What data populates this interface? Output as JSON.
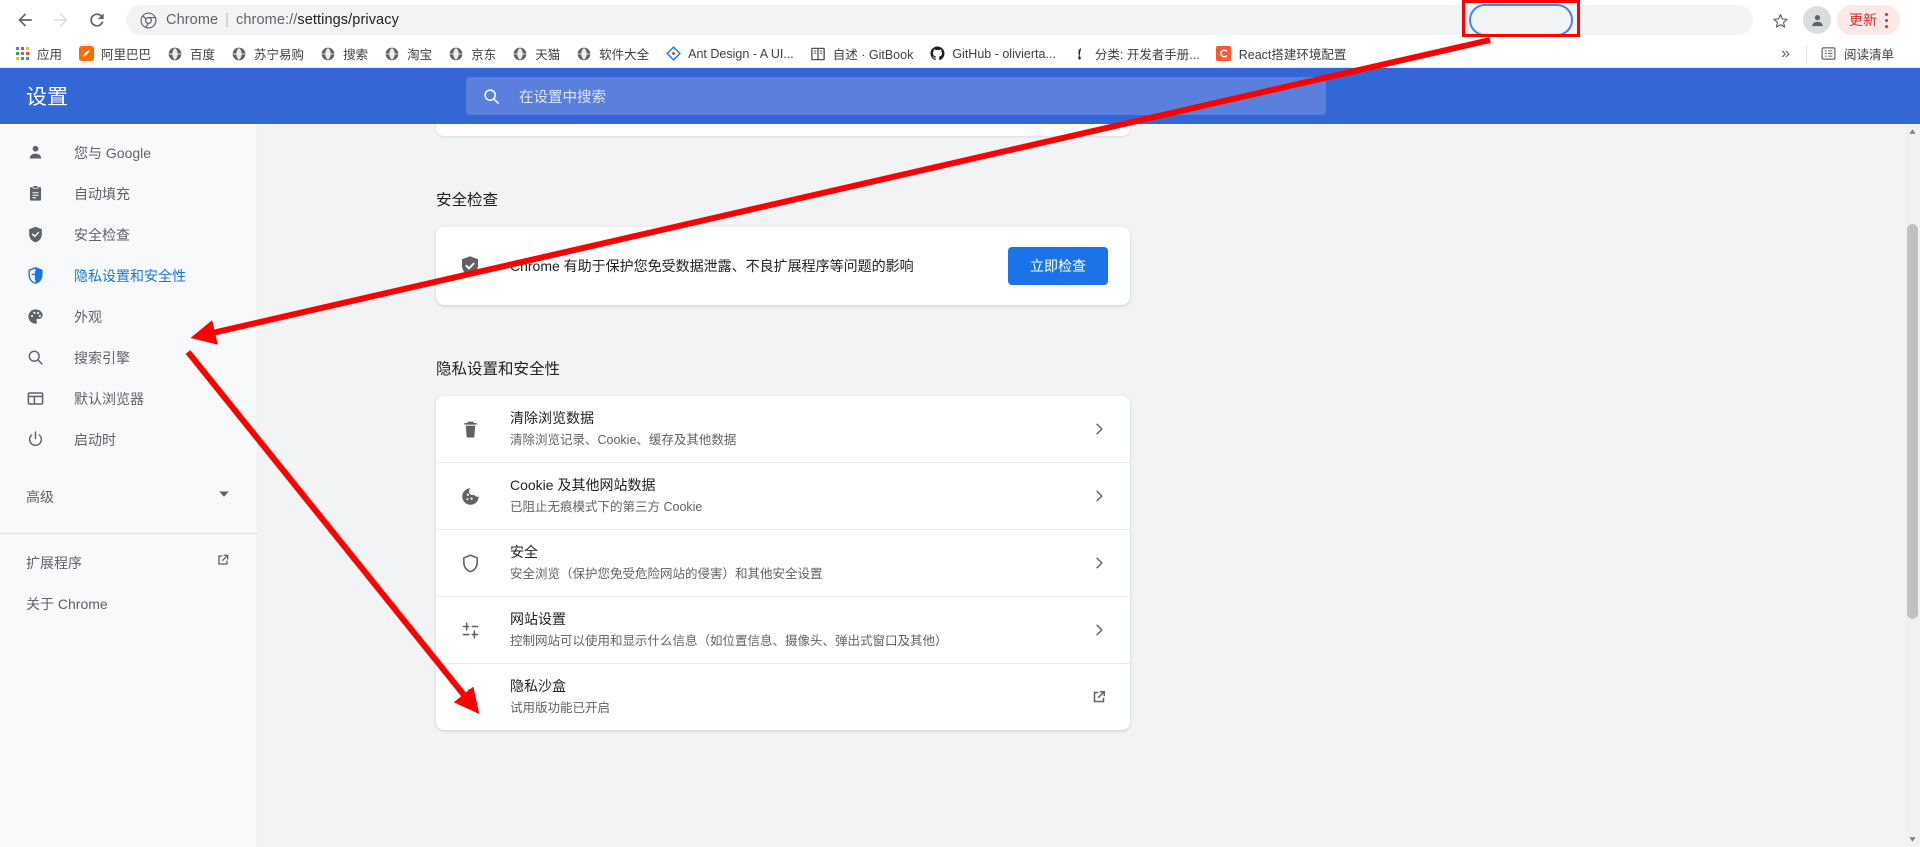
{
  "browser": {
    "nav": {
      "back_label": "后退",
      "forward_label": "前进",
      "reload_label": "重新加载"
    },
    "omnibox": {
      "site_label": "Chrome",
      "separator": "|",
      "url_scheme": "chrome://",
      "url_path": "settings/privacy",
      "full_url": "chrome://settings/privacy"
    },
    "actions": {
      "bookmark_label": "为此标签页添加书签",
      "profile_label": "个人资料",
      "update_label": "更新",
      "menu_label": "自定义及控制 Google Chrome"
    },
    "bookmarks": [
      {
        "label": "应用",
        "icon": "apps-grid-icon"
      },
      {
        "label": "阿里巴巴",
        "icon": "alibaba-icon"
      },
      {
        "label": "百度",
        "icon": "globe-icon"
      },
      {
        "label": "苏宁易购",
        "icon": "globe-icon"
      },
      {
        "label": "搜索",
        "icon": "globe-icon"
      },
      {
        "label": "淘宝",
        "icon": "globe-icon"
      },
      {
        "label": "京东",
        "icon": "globe-icon"
      },
      {
        "label": "天猫",
        "icon": "globe-icon"
      },
      {
        "label": "软件大全",
        "icon": "globe-icon"
      },
      {
        "label": "Ant Design - A UI...",
        "icon": "antdesign-icon"
      },
      {
        "label": "自述 · GitBook",
        "icon": "gitbook-icon"
      },
      {
        "label": "GitHub - olivierta...",
        "icon": "github-icon"
      },
      {
        "label": "分类: 开发者手册...",
        "icon": "brush-icon"
      },
      {
        "label": "React搭建环境配置",
        "icon": "csdn-icon"
      }
    ],
    "bookmarks_overflow": "»",
    "reading_list": {
      "label": "阅读清单",
      "icon": "reading-list-icon"
    }
  },
  "settings": {
    "title": "设置",
    "search": {
      "placeholder": "在设置中搜索",
      "icon": "search-icon"
    },
    "sidebar": {
      "items": [
        {
          "label": "您与 Google",
          "icon": "person-icon",
          "active": false
        },
        {
          "label": "自动填充",
          "icon": "clipboard-icon",
          "active": false
        },
        {
          "label": "安全检查",
          "icon": "shield-check-icon",
          "active": false
        },
        {
          "label": "隐私设置和安全性",
          "icon": "shield-blue-icon",
          "active": true
        },
        {
          "label": "外观",
          "icon": "palette-icon",
          "active": false
        },
        {
          "label": "搜索引擎",
          "icon": "search-icon",
          "active": false
        },
        {
          "label": "默认浏览器",
          "icon": "browser-window-icon",
          "active": false
        },
        {
          "label": "启动时",
          "icon": "power-icon",
          "active": false
        }
      ],
      "advanced": {
        "label": "高级",
        "icon": "chevron-down-icon"
      },
      "links": [
        {
          "label": "扩展程序",
          "icon": "open-in-new-icon"
        },
        {
          "label": "关于 Chrome",
          "icon": "none"
        }
      ]
    },
    "main": {
      "safety_check": {
        "heading": "安全检查",
        "icon": "shield-check-icon",
        "description": "Chrome 有助于保护您免受数据泄露、不良扩展程序等问题的影响",
        "button_label": "立即检查"
      },
      "privacy": {
        "heading": "隐私设置和安全性",
        "rows": [
          {
            "icon": "trash-icon",
            "title": "清除浏览数据",
            "subtitle": "清除浏览记录、Cookie、缓存及其他数据",
            "end_icon": "chevron-right-icon"
          },
          {
            "icon": "cookie-icon",
            "title": "Cookie 及其他网站数据",
            "subtitle": "已阻止无痕模式下的第三方 Cookie",
            "end_icon": "chevron-right-icon"
          },
          {
            "icon": "shield-outline-icon",
            "title": "安全",
            "subtitle": "安全浏览（保护您免受危险网站的侵害）和其他安全设置",
            "end_icon": "chevron-right-icon"
          },
          {
            "icon": "sliders-icon",
            "title": "网站设置",
            "subtitle": "控制网站可以使用和显示什么信息（如位置信息、摄像头、弹出式窗口及其他）",
            "end_icon": "chevron-right-icon"
          },
          {
            "icon": "flask-icon",
            "title": "隐私沙盒",
            "subtitle": "试用版功能已开启",
            "end_icon": "open-in-new-icon"
          }
        ]
      }
    }
  },
  "annotations": {
    "highlight_color": "#ff0000",
    "oval_color": "#4285f4",
    "arrows": [
      {
        "name": "arrow-to-privacy-sidebar",
        "from": "update-button",
        "to": "sidebar-item-privacy"
      },
      {
        "name": "arrow-to-site-settings",
        "from": "sidebar-item-privacy",
        "to": "row-site-settings"
      }
    ]
  }
}
